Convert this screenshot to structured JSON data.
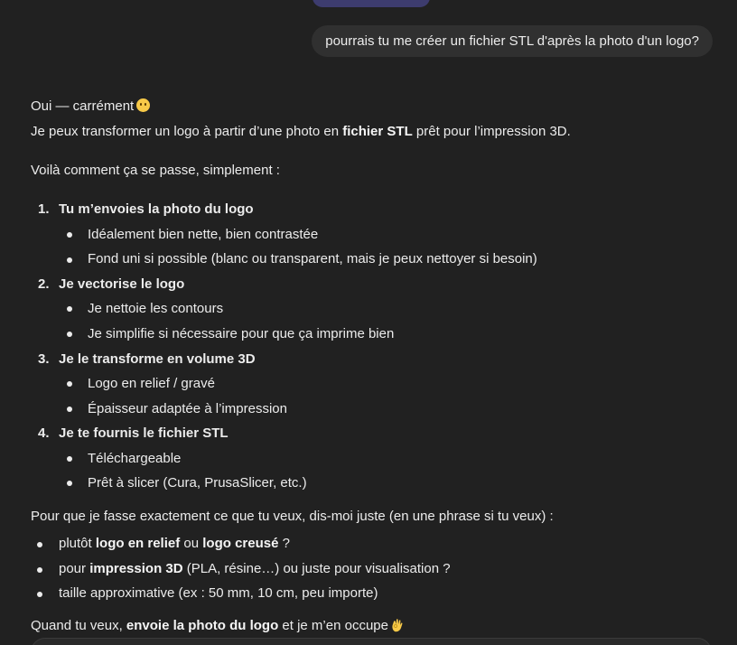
{
  "user_message": "pourrais tu me créer un fichier STL d'après la photo d'un logo?",
  "reply": {
    "greeting": "Oui — carrément",
    "greeting_emoji": "smiling-face-icon",
    "intro_a": "Je peux transformer un logo à partir d’une photo en ",
    "intro_bold": "fichier STL",
    "intro_b": " prêt pour l’impression 3D.",
    "how": "Voilà comment ça se passe, simplement :",
    "steps": [
      {
        "num": "1.",
        "title": "Tu m’envoies la photo du logo",
        "items": [
          "Idéalement bien nette, bien contrastée",
          "Fond uni si possible (blanc ou transparent, mais je peux nettoyer si besoin)"
        ]
      },
      {
        "num": "2.",
        "title": "Je vectorise le logo",
        "items": [
          "Je nettoie les contours",
          "Je simplifie si nécessaire pour que ça imprime bien"
        ]
      },
      {
        "num": "3.",
        "title": "Je le transforme en volume 3D",
        "items": [
          "Logo en relief / gravé",
          "Épaisseur adaptée à l’impression"
        ]
      },
      {
        "num": "4.",
        "title": "Je te fournis le fichier STL",
        "items": [
          "Téléchargeable",
          "Prêt à slicer (Cura, PrusaSlicer, etc.)"
        ]
      }
    ],
    "ask": "Pour que je fasse exactement ce que tu veux, dis-moi juste (en une phrase si tu veux) :",
    "q1_a": "plutôt ",
    "q1_b1": "logo en relief",
    "q1_mid": " ou ",
    "q1_b2": "logo creusé",
    "q1_end": " ?",
    "q2_a": "pour ",
    "q2_b": "impression 3D",
    "q2_end": " (PLA, résine…) ou juste pour visualisation ?",
    "q3": "taille approximative (ex : 50 mm, 10 cm, peu importe)",
    "closing_a": "Quand tu veux, ",
    "closing_b": "envoie la photo du logo",
    "closing_c": " et je m’en occupe",
    "closing_emoji": "ok-hand-icon"
  }
}
